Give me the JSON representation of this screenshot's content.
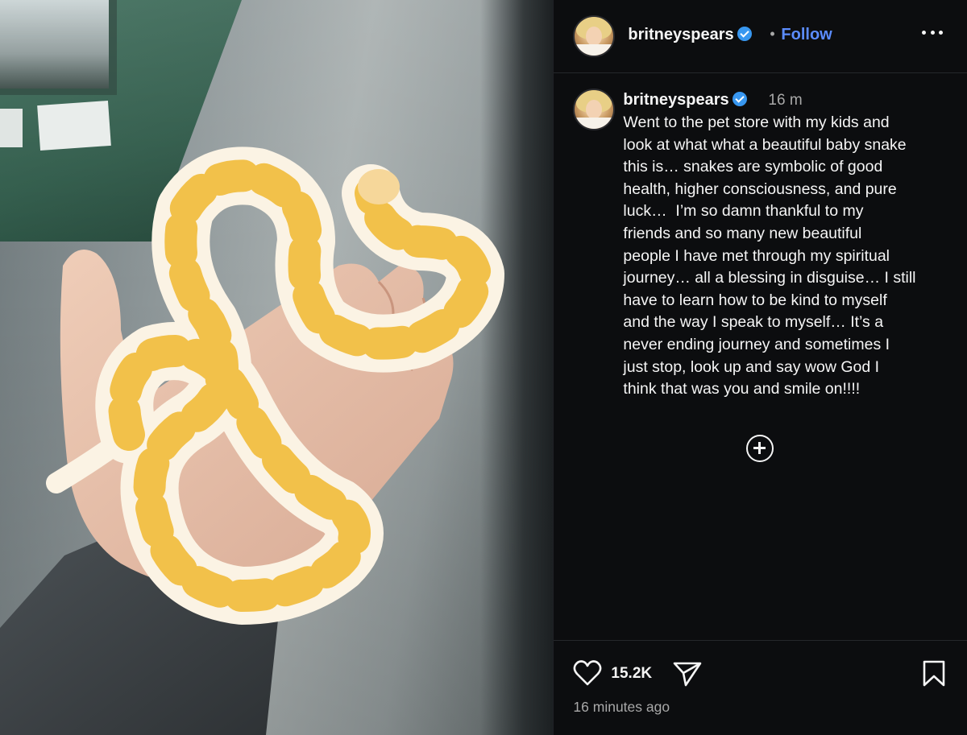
{
  "post": {
    "photo": {
      "subject": "albino ball python in hand",
      "colors": {
        "snake_yellow": "#f2c14a",
        "snake_white": "#fbf3e4",
        "sleeve": "#3e4347",
        "skin": "#e9c2ae"
      }
    },
    "header": {
      "username": "britneyspears",
      "verified_icon": "verified-badge-icon",
      "separator": "•",
      "follow_label": "Follow",
      "more_icon": "more-options-icon"
    },
    "caption": {
      "username": "britneyspears",
      "time": "16 m",
      "text": "Went to the pet store with my kids and\nlook at what what a beautiful baby snake\nthis is… snakes are symbolic of good\nhealth, higher consciousness, and pure\nluck…  I’m so damn thankful to my\nfriends and so many new beautiful\npeople I have met through my spiritual\njourney… all a blessing in disguise… I still\nhave to learn how to be kind to myself\nand the way I speak to myself… It’s a\nnever ending journey and sometimes I\njust stop, look up and say wow God I\nthink that was you and smile on!!!!",
      "load_more_icon": "plus-circle-icon"
    },
    "actions": {
      "like_icon": "heart-icon",
      "likes": "15.2K",
      "share_icon": "send-icon",
      "save_icon": "bookmark-icon"
    },
    "posted_ago": "16 minutes ago",
    "colors": {
      "panel_bg": "#0c0d0f",
      "text": "#f5f5f5",
      "secondary_text": "#a8a8a8",
      "follow": "#5b8cff",
      "verified": "#3897f0"
    }
  }
}
